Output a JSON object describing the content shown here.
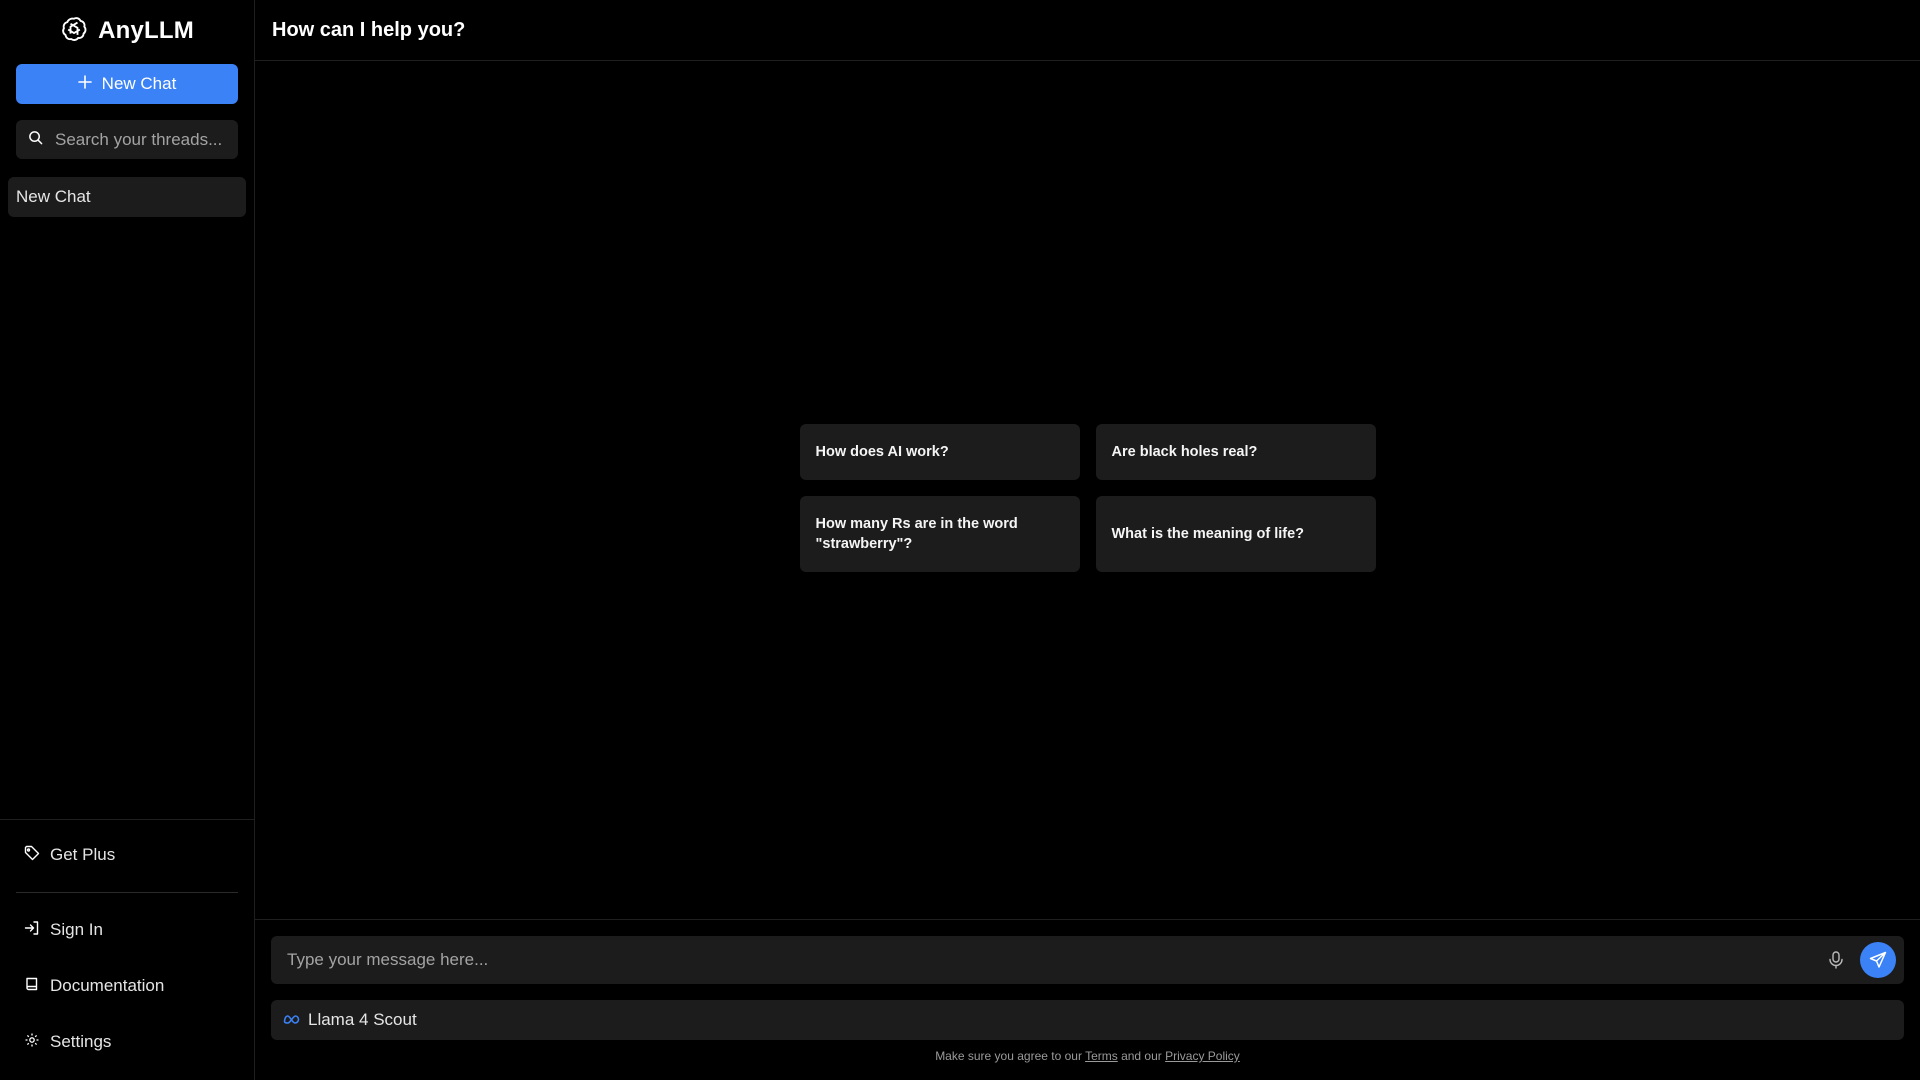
{
  "colors": {
    "accent": "#3b82f6",
    "panel": "#1c1c1c",
    "background": "#000000",
    "meta_blue": "#3b82f6"
  },
  "sidebar": {
    "brand": {
      "name": "AnyLLM",
      "icon": "openai-logo-icon"
    },
    "new_chat_label": "New Chat",
    "search": {
      "placeholder": "Search your threads...",
      "value": ""
    },
    "threads": [
      {
        "label": "New Chat"
      }
    ],
    "bottom": {
      "get_plus": "Get Plus",
      "sign_in": "Sign In",
      "documentation": "Documentation",
      "settings": "Settings"
    }
  },
  "main": {
    "title": "How can I help you?",
    "suggestions": [
      "How does AI work?",
      "Are black holes real?",
      "How many Rs are in the word \"strawberry\"?",
      "What is the meaning of life?"
    ],
    "composer": {
      "placeholder": "Type your message here...",
      "value": ""
    },
    "model": {
      "name": "Llama 4 Scout",
      "icon": "meta-logo-icon"
    },
    "legal": {
      "prefix": "Make sure you agree to our ",
      "terms": "Terms",
      "middle": " and our ",
      "privacy": "Privacy Policy"
    }
  }
}
